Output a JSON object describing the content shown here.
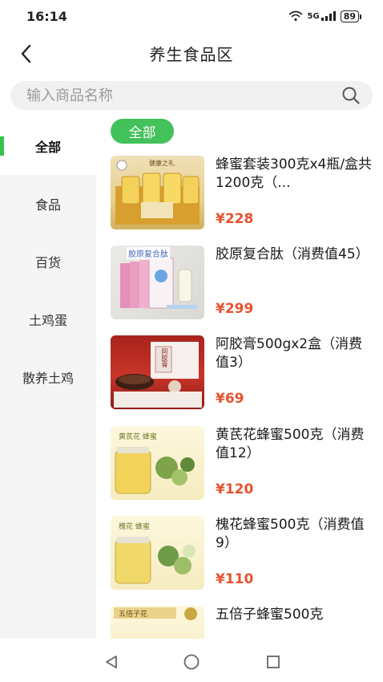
{
  "status_bar": {
    "time": "16:14",
    "network": "5G",
    "battery": "89"
  },
  "header": {
    "title": "养生食品区",
    "back_icon": "chevron-left-icon"
  },
  "search": {
    "placeholder": "输入商品名称",
    "icon": "search-icon"
  },
  "sidebar": {
    "items": [
      {
        "label": "全部",
        "active": true
      },
      {
        "label": "食品",
        "active": false
      },
      {
        "label": "百货",
        "active": false
      },
      {
        "label": "土鸡蛋",
        "active": false
      },
      {
        "label": "散养土鸡",
        "active": false
      }
    ],
    "accent_color": "#35c24b"
  },
  "category_chip": {
    "label": "全部",
    "color": "#43c15a"
  },
  "products": [
    {
      "name": "蜂蜜套装300克x4瓶/盒共1200克（...",
      "price": "¥228",
      "thumb_text": "健康之礼"
    },
    {
      "name": "胶原复合肽（消费值45）",
      "price": "¥299",
      "thumb_text": "胶原复合肽"
    },
    {
      "name": "阿胶膏500gx2盒（消费值3）",
      "price": "¥69",
      "thumb_text": "阿胶膏"
    },
    {
      "name": "黄芪花蜂蜜500克（消费值12）",
      "price": "¥120",
      "thumb_text": "黄芪花 蜂蜜"
    },
    {
      "name": "槐花蜂蜜500克（消费值9）",
      "price": "¥110",
      "thumb_text": "槐花 蜂蜜"
    },
    {
      "name": "五倍子蜂蜜500克",
      "price": "",
      "thumb_text": "五倍子花"
    }
  ],
  "price_color": "#e6532f",
  "system_nav": {
    "back": "triangle-back-icon",
    "home": "circle-home-icon",
    "recents": "square-recents-icon"
  }
}
